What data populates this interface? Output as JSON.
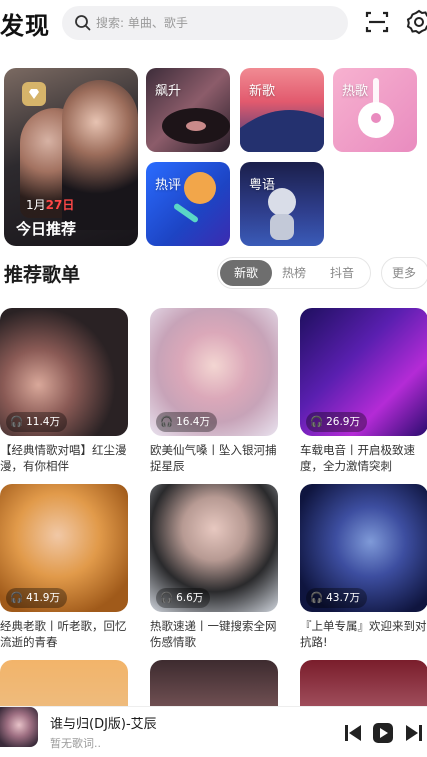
{
  "header": {
    "title": "发现",
    "search_placeholder": "搜索: 单曲、歌手"
  },
  "featured": {
    "daily": {
      "date_prefix": "1月",
      "date_day": "27日",
      "label": "今日推荐"
    },
    "tiles": [
      {
        "label": "飙升"
      },
      {
        "label": "新歌"
      },
      {
        "label": "热歌"
      },
      {
        "label": "热评"
      },
      {
        "label": "粤语"
      }
    ]
  },
  "section": {
    "title": "推荐歌单",
    "tabs": [
      "新歌",
      "热榜",
      "抖音"
    ],
    "active_tab": "新歌",
    "more_label": "更多"
  },
  "playlists": [
    {
      "count": "11.4万",
      "title": "【经典情歌对唱】红尘漫漫，有你相伴"
    },
    {
      "count": "16.4万",
      "title": "欧美仙气嗓丨坠入银河捕捉星辰"
    },
    {
      "count": "26.9万",
      "title": "车载电音丨开启极致速度，全力激情突刺"
    },
    {
      "count": "41.9万",
      "title": "经典老歌丨听老歌，回忆流逝的青春"
    },
    {
      "count": "6.6万",
      "title": "热歌速递丨一键搜索全网伤感情歌"
    },
    {
      "count": "43.7万",
      "title": "『上单专属』欢迎来到对抗路!"
    },
    {
      "count": "",
      "title": ""
    },
    {
      "count": "",
      "title": ""
    },
    {
      "count": "",
      "title": ""
    }
  ],
  "player": {
    "song": "谁与归(DJ版)-艾辰",
    "lyric": "暂无歌词.."
  }
}
